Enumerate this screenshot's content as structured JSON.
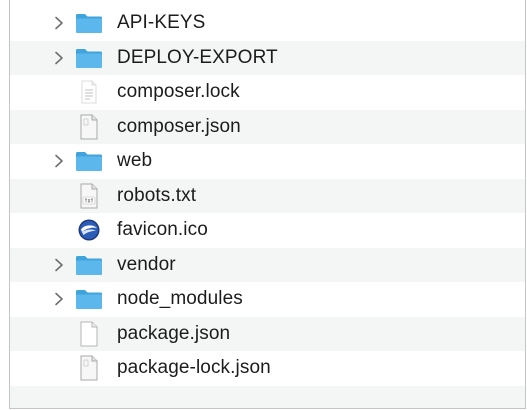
{
  "finder": {
    "items": [
      {
        "name": "API-KEYS",
        "kind": "folder",
        "expandable": true,
        "icon": "folder-icon"
      },
      {
        "name": "DEPLOY-EXPORT",
        "kind": "folder",
        "expandable": true,
        "icon": "folder-icon"
      },
      {
        "name": "composer.lock",
        "kind": "text-file",
        "expandable": false,
        "icon": "text-document-icon"
      },
      {
        "name": "composer.json",
        "kind": "generic-file",
        "expandable": false,
        "icon": "document-icon"
      },
      {
        "name": "web",
        "kind": "folder",
        "expandable": true,
        "icon": "folder-icon"
      },
      {
        "name": "robots.txt",
        "kind": "txt-file",
        "expandable": false,
        "icon": "txt-document-icon"
      },
      {
        "name": "favicon.ico",
        "kind": "ico-file",
        "expandable": false,
        "icon": "favicon-icon"
      },
      {
        "name": "vendor",
        "kind": "folder",
        "expandable": true,
        "icon": "folder-icon"
      },
      {
        "name": "node_modules",
        "kind": "folder",
        "expandable": true,
        "icon": "folder-icon"
      },
      {
        "name": "package.json",
        "kind": "blank-file",
        "expandable": false,
        "icon": "blank-document-icon"
      },
      {
        "name": "package-lock.json",
        "kind": "generic-file",
        "expandable": false,
        "icon": "document-icon"
      }
    ]
  },
  "colors": {
    "folder": "#5cb8ec",
    "folder_tab": "#3fa3dc",
    "row_stripe": "#f4f5f5",
    "chevron": "#6e6e6e"
  }
}
